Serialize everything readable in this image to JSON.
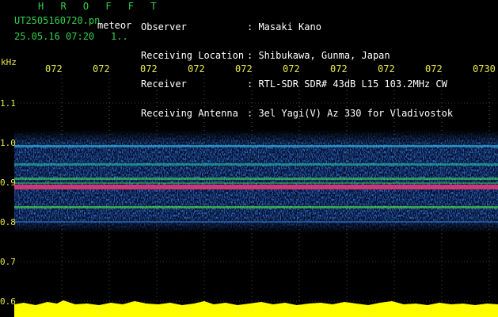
{
  "header": {
    "title": "H R O F F T",
    "filename": "UT2505160720.pn",
    "meteor_label": "meteor",
    "datetime": "25.05.16 07:20",
    "separator": "1.."
  },
  "meta": [
    {
      "label": "Observer",
      "value": ": Masaki Kano"
    },
    {
      "label": "Receiving Location",
      "value": ": Shibukawa, Gunma, Japan"
    },
    {
      "label": "Receiver",
      "value": ": RTL-SDR SDR# 43dB L15 103.2MHz CW"
    },
    {
      "label": "Receiving Antenna",
      "value": ": 3el Yagi(V) Az 330 for Vladivostok"
    }
  ],
  "axes": {
    "y_unit": "kHz",
    "x_ticks": [
      "072",
      "072",
      "072",
      "072",
      "072",
      "072",
      "072",
      "072",
      "072",
      "0730"
    ],
    "y_ticks": [
      "1.1",
      "1.0",
      "0.9",
      "0.8",
      "0.7",
      "0.6"
    ]
  },
  "colors": {
    "label_green": "#34d14a",
    "tick_yellow": "#e8e84a",
    "trace_yellow": "#ffff00",
    "background": "#000000"
  }
}
